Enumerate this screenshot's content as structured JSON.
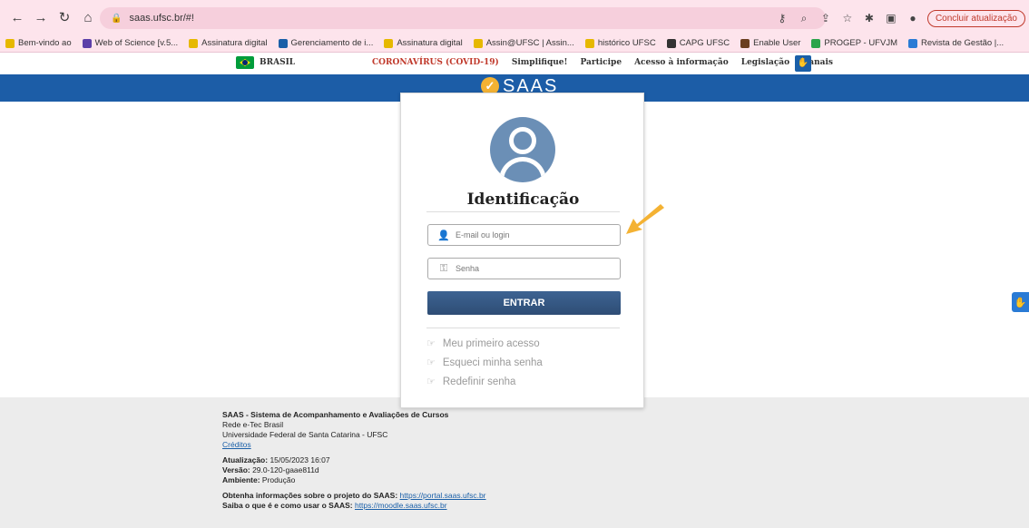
{
  "browser": {
    "url": "saas.ufsc.br/#!",
    "update_label": "Concluir atualização",
    "bookmarks": [
      {
        "label": "Bem-vindo ao",
        "color": "#e6b800"
      },
      {
        "label": "Web of Science [v.5...",
        "color": "#5b3fa8"
      },
      {
        "label": "Assinatura digital",
        "color": "#e6b800"
      },
      {
        "label": "Gerenciamento de i...",
        "color": "#1a5fa8"
      },
      {
        "label": "Assinatura digital",
        "color": "#e6b800"
      },
      {
        "label": "Assin@UFSC | Assin...",
        "color": "#e6b800"
      },
      {
        "label": "histórico UFSC",
        "color": "#e6b800"
      },
      {
        "label": "CAPG UFSC",
        "color": "#333333"
      },
      {
        "label": "Enable User",
        "color": "#6a3e1f"
      },
      {
        "label": "PROGEP - UFVJM",
        "color": "#2aa44a"
      },
      {
        "label": "Revista de Gestão |...",
        "color": "#2a7bd5"
      }
    ]
  },
  "gov_bar": {
    "brasil": "BRASIL",
    "links": [
      {
        "label": "CORONAVÍRUS (COVID-19)",
        "kind": "covid"
      },
      {
        "label": "Simplifique!",
        "kind": "normal"
      },
      {
        "label": "Participe",
        "kind": "normal"
      },
      {
        "label": "Acesso à informação",
        "kind": "normal"
      },
      {
        "label": "Legislação",
        "kind": "normal"
      },
      {
        "label": "Canais",
        "kind": "normal"
      }
    ]
  },
  "header": {
    "logo_text": "SAAS"
  },
  "login": {
    "title": "Identificação",
    "email_placeholder": "E-mail ou login",
    "password_placeholder": "Senha",
    "submit_label": "ENTRAR",
    "links": [
      "Meu primeiro acesso",
      "Esqueci minha senha",
      "Redefinir senha"
    ]
  },
  "footer": {
    "system_title": "SAAS - Sistema de Acompanhamento e Avaliações de Cursos",
    "network": "Rede e-Tec Brasil",
    "university": "Universidade Federal de Santa Catarina - UFSC",
    "credits_label": "Créditos",
    "updated_label": "Atualização:",
    "updated_value": " 15/05/2023 16:07",
    "version_label": "Versão:",
    "version_value": " 29.0-120-gaae811d",
    "env_label": "Ambiente:",
    "env_value": " Produção",
    "project_info_label": "Obtenha informações sobre o projeto do SAAS:",
    "project_info_url": "https://portal.saas.ufsc.br",
    "howto_label": "Saiba o que é e como usar o SAAS:",
    "howto_url": "https://moodle.saas.ufsc.br"
  },
  "colors": {
    "brand_blue": "#1c5da7",
    "accent_orange": "#f4b233",
    "button": "#2e4d75"
  }
}
